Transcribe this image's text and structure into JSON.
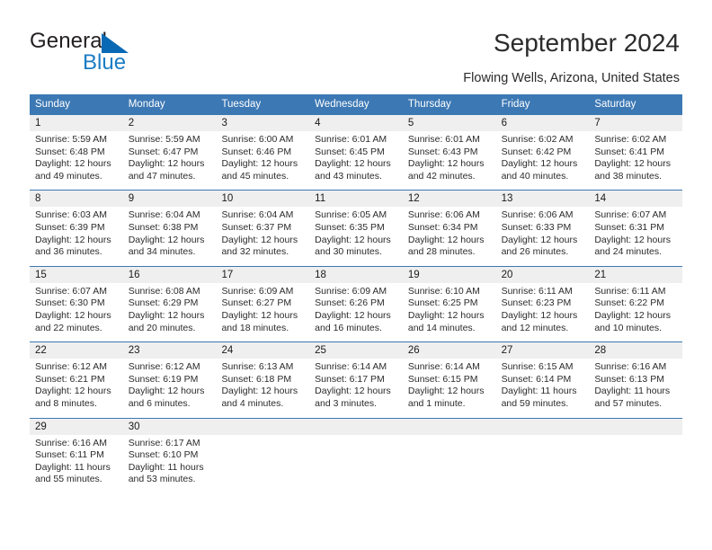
{
  "brand": {
    "name_top": "General",
    "name_bottom": "Blue",
    "color_top": "#231f20",
    "color_bottom": "#1a7cc4",
    "triangle_color": "#0a69b4"
  },
  "header": {
    "title": "September 2024",
    "subtitle": "Flowing Wells, Arizona, United States",
    "header_bg": "#3c78b4",
    "header_text_color": "#ffffff",
    "daynum_bg": "#efefef"
  },
  "weekday_headers": [
    "Sunday",
    "Monday",
    "Tuesday",
    "Wednesday",
    "Thursday",
    "Friday",
    "Saturday"
  ],
  "weeks": [
    [
      {
        "day": "1",
        "sunrise": "Sunrise: 5:59 AM",
        "sunset": "Sunset: 6:48 PM",
        "daylight_1": "Daylight: 12 hours",
        "daylight_2": "and 49 minutes."
      },
      {
        "day": "2",
        "sunrise": "Sunrise: 5:59 AM",
        "sunset": "Sunset: 6:47 PM",
        "daylight_1": "Daylight: 12 hours",
        "daylight_2": "and 47 minutes."
      },
      {
        "day": "3",
        "sunrise": "Sunrise: 6:00 AM",
        "sunset": "Sunset: 6:46 PM",
        "daylight_1": "Daylight: 12 hours",
        "daylight_2": "and 45 minutes."
      },
      {
        "day": "4",
        "sunrise": "Sunrise: 6:01 AM",
        "sunset": "Sunset: 6:45 PM",
        "daylight_1": "Daylight: 12 hours",
        "daylight_2": "and 43 minutes."
      },
      {
        "day": "5",
        "sunrise": "Sunrise: 6:01 AM",
        "sunset": "Sunset: 6:43 PM",
        "daylight_1": "Daylight: 12 hours",
        "daylight_2": "and 42 minutes."
      },
      {
        "day": "6",
        "sunrise": "Sunrise: 6:02 AM",
        "sunset": "Sunset: 6:42 PM",
        "daylight_1": "Daylight: 12 hours",
        "daylight_2": "and 40 minutes."
      },
      {
        "day": "7",
        "sunrise": "Sunrise: 6:02 AM",
        "sunset": "Sunset: 6:41 PM",
        "daylight_1": "Daylight: 12 hours",
        "daylight_2": "and 38 minutes."
      }
    ],
    [
      {
        "day": "8",
        "sunrise": "Sunrise: 6:03 AM",
        "sunset": "Sunset: 6:39 PM",
        "daylight_1": "Daylight: 12 hours",
        "daylight_2": "and 36 minutes."
      },
      {
        "day": "9",
        "sunrise": "Sunrise: 6:04 AM",
        "sunset": "Sunset: 6:38 PM",
        "daylight_1": "Daylight: 12 hours",
        "daylight_2": "and 34 minutes."
      },
      {
        "day": "10",
        "sunrise": "Sunrise: 6:04 AM",
        "sunset": "Sunset: 6:37 PM",
        "daylight_1": "Daylight: 12 hours",
        "daylight_2": "and 32 minutes."
      },
      {
        "day": "11",
        "sunrise": "Sunrise: 6:05 AM",
        "sunset": "Sunset: 6:35 PM",
        "daylight_1": "Daylight: 12 hours",
        "daylight_2": "and 30 minutes."
      },
      {
        "day": "12",
        "sunrise": "Sunrise: 6:06 AM",
        "sunset": "Sunset: 6:34 PM",
        "daylight_1": "Daylight: 12 hours",
        "daylight_2": "and 28 minutes."
      },
      {
        "day": "13",
        "sunrise": "Sunrise: 6:06 AM",
        "sunset": "Sunset: 6:33 PM",
        "daylight_1": "Daylight: 12 hours",
        "daylight_2": "and 26 minutes."
      },
      {
        "day": "14",
        "sunrise": "Sunrise: 6:07 AM",
        "sunset": "Sunset: 6:31 PM",
        "daylight_1": "Daylight: 12 hours",
        "daylight_2": "and 24 minutes."
      }
    ],
    [
      {
        "day": "15",
        "sunrise": "Sunrise: 6:07 AM",
        "sunset": "Sunset: 6:30 PM",
        "daylight_1": "Daylight: 12 hours",
        "daylight_2": "and 22 minutes."
      },
      {
        "day": "16",
        "sunrise": "Sunrise: 6:08 AM",
        "sunset": "Sunset: 6:29 PM",
        "daylight_1": "Daylight: 12 hours",
        "daylight_2": "and 20 minutes."
      },
      {
        "day": "17",
        "sunrise": "Sunrise: 6:09 AM",
        "sunset": "Sunset: 6:27 PM",
        "daylight_1": "Daylight: 12 hours",
        "daylight_2": "and 18 minutes."
      },
      {
        "day": "18",
        "sunrise": "Sunrise: 6:09 AM",
        "sunset": "Sunset: 6:26 PM",
        "daylight_1": "Daylight: 12 hours",
        "daylight_2": "and 16 minutes."
      },
      {
        "day": "19",
        "sunrise": "Sunrise: 6:10 AM",
        "sunset": "Sunset: 6:25 PM",
        "daylight_1": "Daylight: 12 hours",
        "daylight_2": "and 14 minutes."
      },
      {
        "day": "20",
        "sunrise": "Sunrise: 6:11 AM",
        "sunset": "Sunset: 6:23 PM",
        "daylight_1": "Daylight: 12 hours",
        "daylight_2": "and 12 minutes."
      },
      {
        "day": "21",
        "sunrise": "Sunrise: 6:11 AM",
        "sunset": "Sunset: 6:22 PM",
        "daylight_1": "Daylight: 12 hours",
        "daylight_2": "and 10 minutes."
      }
    ],
    [
      {
        "day": "22",
        "sunrise": "Sunrise: 6:12 AM",
        "sunset": "Sunset: 6:21 PM",
        "daylight_1": "Daylight: 12 hours",
        "daylight_2": "and 8 minutes."
      },
      {
        "day": "23",
        "sunrise": "Sunrise: 6:12 AM",
        "sunset": "Sunset: 6:19 PM",
        "daylight_1": "Daylight: 12 hours",
        "daylight_2": "and 6 minutes."
      },
      {
        "day": "24",
        "sunrise": "Sunrise: 6:13 AM",
        "sunset": "Sunset: 6:18 PM",
        "daylight_1": "Daylight: 12 hours",
        "daylight_2": "and 4 minutes."
      },
      {
        "day": "25",
        "sunrise": "Sunrise: 6:14 AM",
        "sunset": "Sunset: 6:17 PM",
        "daylight_1": "Daylight: 12 hours",
        "daylight_2": "and 3 minutes."
      },
      {
        "day": "26",
        "sunrise": "Sunrise: 6:14 AM",
        "sunset": "Sunset: 6:15 PM",
        "daylight_1": "Daylight: 12 hours",
        "daylight_2": "and 1 minute."
      },
      {
        "day": "27",
        "sunrise": "Sunrise: 6:15 AM",
        "sunset": "Sunset: 6:14 PM",
        "daylight_1": "Daylight: 11 hours",
        "daylight_2": "and 59 minutes."
      },
      {
        "day": "28",
        "sunrise": "Sunrise: 6:16 AM",
        "sunset": "Sunset: 6:13 PM",
        "daylight_1": "Daylight: 11 hours",
        "daylight_2": "and 57 minutes."
      }
    ],
    [
      {
        "day": "29",
        "sunrise": "Sunrise: 6:16 AM",
        "sunset": "Sunset: 6:11 PM",
        "daylight_1": "Daylight: 11 hours",
        "daylight_2": "and 55 minutes."
      },
      {
        "day": "30",
        "sunrise": "Sunrise: 6:17 AM",
        "sunset": "Sunset: 6:10 PM",
        "daylight_1": "Daylight: 11 hours",
        "daylight_2": "and 53 minutes."
      },
      {
        "day": "",
        "sunrise": "",
        "sunset": "",
        "daylight_1": "",
        "daylight_2": ""
      },
      {
        "day": "",
        "sunrise": "",
        "sunset": "",
        "daylight_1": "",
        "daylight_2": ""
      },
      {
        "day": "",
        "sunrise": "",
        "sunset": "",
        "daylight_1": "",
        "daylight_2": ""
      },
      {
        "day": "",
        "sunrise": "",
        "sunset": "",
        "daylight_1": "",
        "daylight_2": ""
      },
      {
        "day": "",
        "sunrise": "",
        "sunset": "",
        "daylight_1": "",
        "daylight_2": ""
      }
    ]
  ]
}
